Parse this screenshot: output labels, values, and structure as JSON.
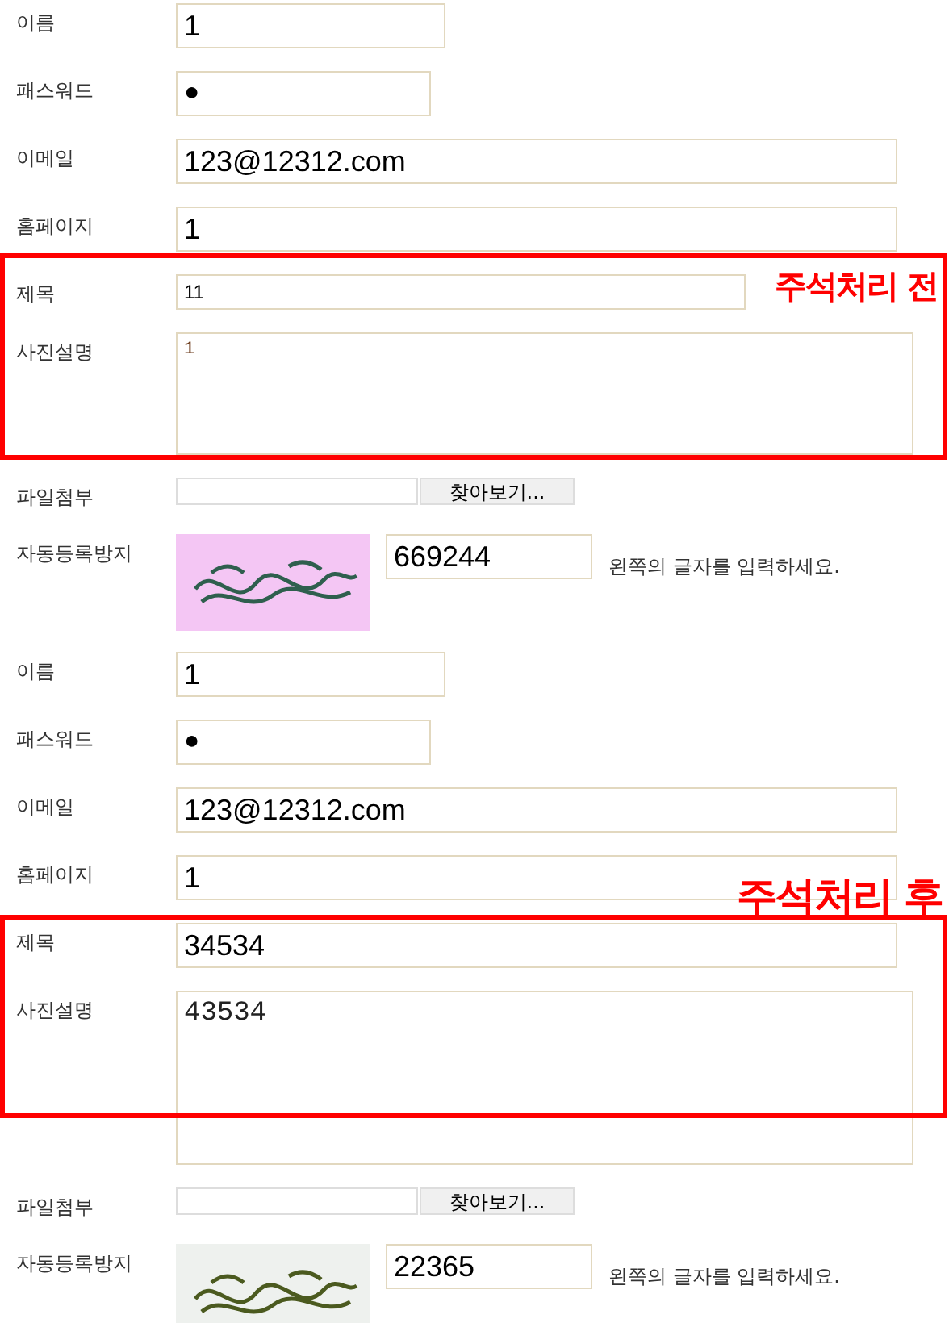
{
  "forms": [
    {
      "fields": [
        {
          "kind": "name",
          "label": "이름",
          "value": "1"
        },
        {
          "kind": "password",
          "label": "패스워드",
          "value": "●"
        },
        {
          "kind": "email",
          "label": "이메일",
          "value": "123@12312.com"
        },
        {
          "kind": "homepage",
          "label": "홈페이지",
          "value": "1"
        }
      ],
      "annotation": {
        "label": "주석처리 전",
        "fields": [
          {
            "kind": "small_title",
            "label": "제목",
            "value": "11"
          },
          {
            "kind": "short_textarea",
            "label": "사진설명",
            "value": "1"
          }
        ]
      },
      "fields_after": [
        {
          "kind": "file",
          "label": "파일첨부",
          "button": "찾아보기..."
        },
        {
          "kind": "captcha",
          "label": "자동등록방지",
          "value": "669244",
          "hint": "왼쪽의 글자를 입력하세요."
        }
      ]
    },
    {
      "fields": [
        {
          "kind": "name",
          "label": "이름",
          "value": "1"
        },
        {
          "kind": "password",
          "label": "패스워드",
          "value": "●"
        },
        {
          "kind": "email",
          "label": "이메일",
          "value": "123@12312.com"
        },
        {
          "kind": "homepage",
          "label": "홈페이지",
          "value": "1"
        }
      ],
      "annotation": {
        "label": "주석처리 후",
        "fields": [
          {
            "kind": "title",
            "label": "제목",
            "value": "34534"
          },
          {
            "kind": "textarea",
            "label": "사진설명",
            "value": "43534"
          }
        ]
      },
      "fields_after": [
        {
          "kind": "file",
          "label": "파일첨부",
          "button": "찾아보기..."
        },
        {
          "kind": "captcha",
          "label": "자동등록방지",
          "value": "22365",
          "hint": "왼쪽의 글자를 입력하세요."
        }
      ]
    }
  ]
}
